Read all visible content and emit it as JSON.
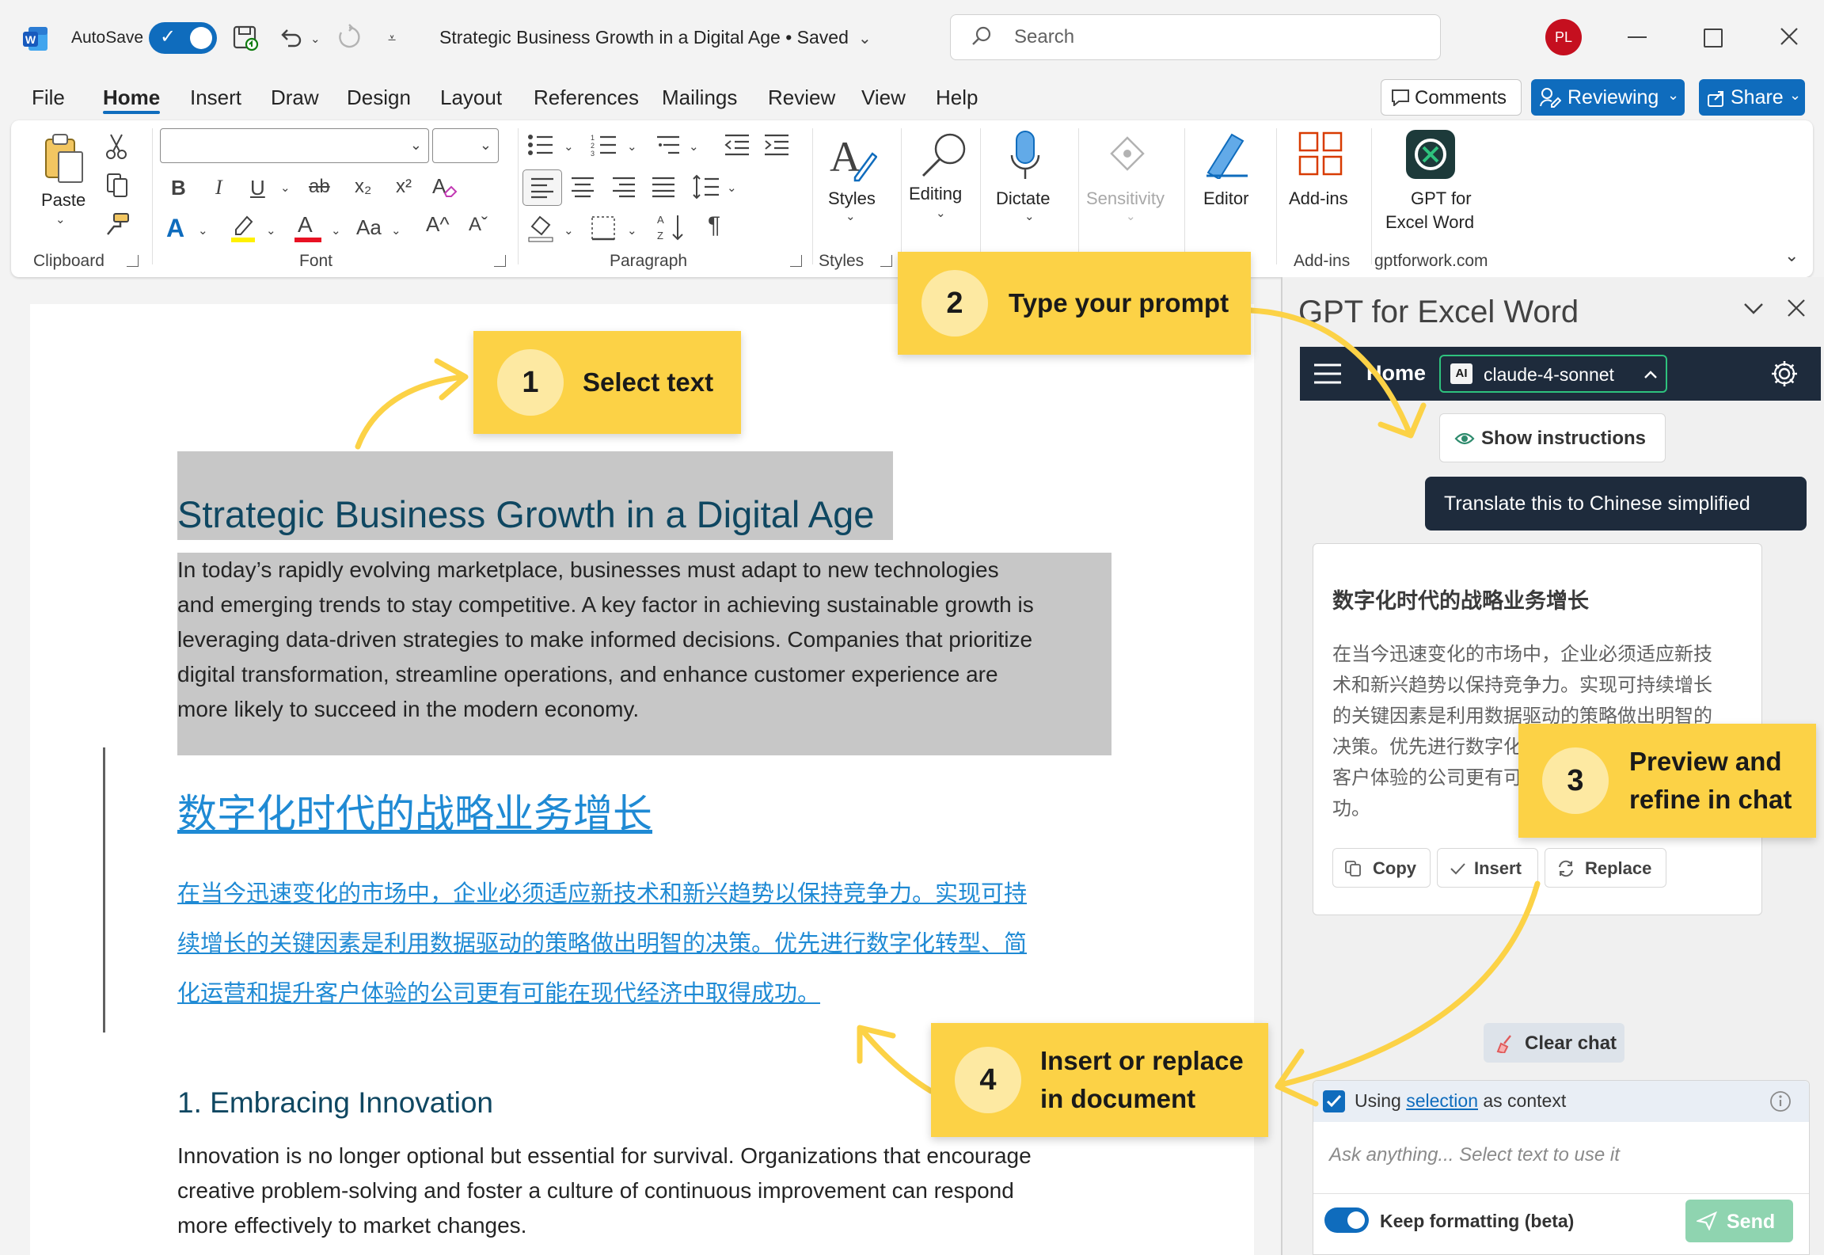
{
  "titlebar": {
    "autosave_label": "AutoSave",
    "doc_title": "Strategic Business Growth in a Digital Age • Saved",
    "search_placeholder": "Search",
    "avatar": "PL",
    "icons": [
      "word-icon",
      "save-icon",
      "undo-icon",
      "redo-icon",
      "customize-icon",
      "search-icon",
      "minimize-icon",
      "maximize-icon",
      "close-icon"
    ]
  },
  "menu": {
    "tabs": [
      "File",
      "Home",
      "Insert",
      "Draw",
      "Design",
      "Layout",
      "References",
      "Mailings",
      "Review",
      "View",
      "Help"
    ],
    "active_tab": "Home",
    "comments": "Comments",
    "reviewing": "Reviewing",
    "share": "Share"
  },
  "ribbon": {
    "paste": "Paste",
    "clipboard": "Clipboard",
    "font": "Font",
    "paragraph": "Paragraph",
    "styles": "Styles",
    "styles_group": "Styles",
    "editing": "Editing",
    "dictate": "Dictate",
    "sensitivity": "Sensitivity",
    "editor": "Editor",
    "addins": "Add-ins",
    "addins_group": "Add-ins",
    "gpt_line1": "GPT for",
    "gpt_line2": "Excel Word",
    "gpt_group": "gptforwork.com",
    "bold": "B",
    "italic": "I",
    "underline": "U",
    "strike": "ab",
    "sub": "x₂",
    "sup": "x²",
    "fontcase": "Aa",
    "grow": "A^",
    "shrink": "Aˇ",
    "font_color_a": "A",
    "text_effect_a": "A",
    "pilcrow": "¶"
  },
  "document": {
    "title": "Strategic Business Growth in a Digital Age",
    "para1": [
      "In today’s rapidly evolving marketplace, businesses must adapt to new technologies",
      "and emerging trends to stay competitive. A key factor in achieving sustainable growth is",
      "leveraging data-driven strategies to make informed decisions. Companies that prioritize",
      "digital transformation, streamline operations, and enhance customer experience are",
      "more likely to succeed in the modern economy."
    ],
    "cn_title": "数字化时代的战略业务增长",
    "cn_para": [
      "在当今迅速变化的市场中，企业必须适应新技术和新兴趋势以保持竞争力。实现可持",
      "续增长的关键因素是利用数据驱动的策略做出明智的决策。优先进行数字化转型、简",
      "化运营和提升客户体验的公司更有可能在现代经济中取得成功。"
    ],
    "h1": "1. Embracing Innovation",
    "para2": [
      "Innovation is no longer optional but essential for survival. Organizations that encourage",
      "creative problem-solving and foster a culture of continuous improvement can respond",
      "more effectively to market changes."
    ]
  },
  "panel": {
    "title": "GPT for Excel Word",
    "nav_home": "Home",
    "model": "claude-4-sonnet",
    "model_badge": "AI",
    "show_instructions": "Show instructions",
    "user_msg": "Translate this to Chinese simplified",
    "reply_title": "数字化时代的战略业务增长",
    "reply_lines": [
      "在当今迅速变化的市场中，企业必须适应新技",
      "术和新兴趋势以保持竞争力。实现可持续增长",
      "的关键因素是利用数据驱动的策略做出明智的",
      "决策。优先进行数字化",
      "客户体验的公司更有可",
      "功。"
    ],
    "copy": "Copy",
    "insert": "Insert",
    "replace": "Replace",
    "clear_chat": "Clear chat",
    "using": "Using",
    "selection": "selection",
    "as_context": "as context",
    "ask_placeholder": "Ask anything... Select text to use it",
    "keep_formatting": "Keep formatting (beta)",
    "send": "Send"
  },
  "callouts": [
    {
      "num": "1",
      "text": "Select text"
    },
    {
      "num": "2",
      "text": "Type your prompt"
    },
    {
      "num": "3",
      "line1": "Preview and",
      "line2": "refine in chat"
    },
    {
      "num": "4",
      "line1": "Insert or replace",
      "line2": "in document"
    }
  ],
  "colors": {
    "word_blue": "#0f6cbd",
    "callout": "#fcd246",
    "panel_nav": "#1e2b3c",
    "doc_title": "#0f4761",
    "cn_link": "#1f8ad4",
    "selection": "#c7c7c7",
    "send_disabled": "#8fd4b0"
  }
}
